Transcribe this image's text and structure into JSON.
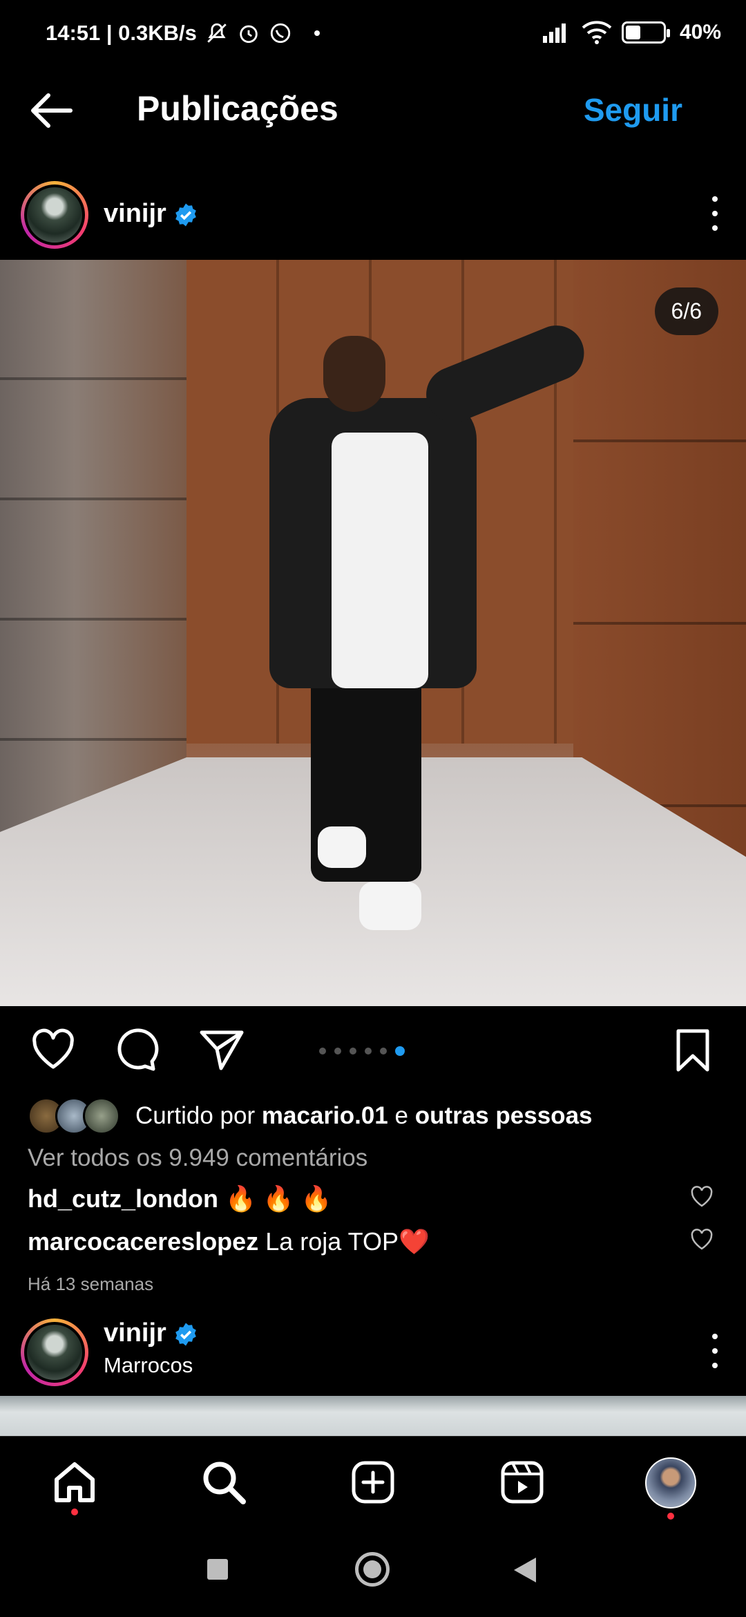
{
  "status_bar": {
    "time_speed": "14:51 | 0.3KB/s",
    "battery_level": "40%",
    "battery_fraction": 0.4,
    "icons": [
      "mute-icon",
      "alarm-icon",
      "whatsapp-icon",
      "signal-icon",
      "wifi-icon",
      "battery-icon"
    ]
  },
  "header": {
    "title": "Publicações",
    "follow_label": "Seguir"
  },
  "post": {
    "username": "vinijr",
    "photo_counter": "6/6",
    "carousel_count": 6,
    "carousel_active": 6,
    "likes_prefix": "Curtido por",
    "likes_user": "macario.01",
    "likes_connector": "e",
    "likes_others": "outras pessoas",
    "view_comments": "Ver todos os 9.949 comentários",
    "comments": [
      {
        "user": "hd_cutz_london",
        "text": "🔥 🔥 🔥"
      },
      {
        "user": "marcocacereslopez",
        "text": "La roja TOP❤️"
      }
    ],
    "time_ago": "Há 13 semanas"
  },
  "next_post": {
    "username": "vinijr",
    "location": "Marrocos"
  },
  "colors": {
    "accent": "#1f9bf0",
    "notification_dot": "#ff3040",
    "secondary_text": "#a8a8a8"
  }
}
